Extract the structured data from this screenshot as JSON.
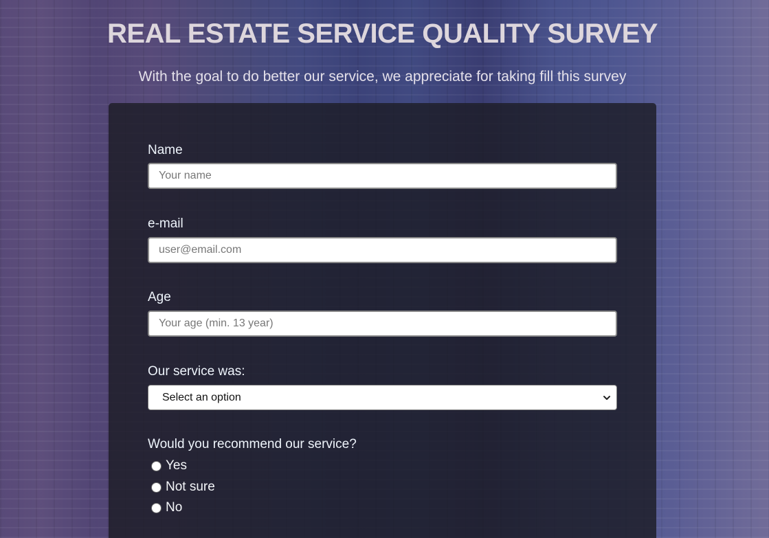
{
  "header": {
    "title": "REAL ESTATE SERVICE QUALITY SURVEY",
    "subtitle": "With the goal to do better our service, we appreciate for taking fill this survey"
  },
  "form": {
    "name": {
      "label": "Name",
      "placeholder": "Your name",
      "value": ""
    },
    "email": {
      "label": "e-mail",
      "placeholder": "user@email.com",
      "value": ""
    },
    "age": {
      "label": "Age",
      "placeholder": "Your age (min. 13 year)",
      "value": ""
    },
    "service": {
      "label": "Our service was:",
      "selected": "Select an option"
    },
    "recommend": {
      "label": "Would you recommend our service?",
      "options": [
        "Yes",
        "Not sure",
        "No"
      ]
    }
  },
  "icons": {
    "select_arrow": "chevron-down-icon"
  },
  "colors": {
    "title": "#ddd6dc",
    "panel": "#1c1c26",
    "label": "#eef4fb"
  }
}
